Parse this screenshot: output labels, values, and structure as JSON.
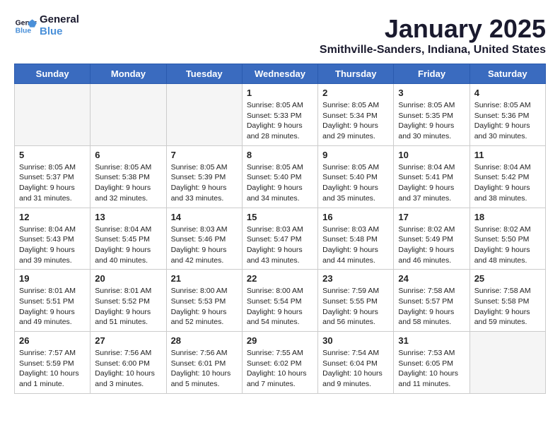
{
  "header": {
    "logo_line1": "General",
    "logo_line2": "Blue",
    "month": "January 2025",
    "location": "Smithville-Sanders, Indiana, United States"
  },
  "weekdays": [
    "Sunday",
    "Monday",
    "Tuesday",
    "Wednesday",
    "Thursday",
    "Friday",
    "Saturday"
  ],
  "weeks": [
    [
      {
        "day": "",
        "info": ""
      },
      {
        "day": "",
        "info": ""
      },
      {
        "day": "",
        "info": ""
      },
      {
        "day": "1",
        "info": "Sunrise: 8:05 AM\nSunset: 5:33 PM\nDaylight: 9 hours\nand 28 minutes."
      },
      {
        "day": "2",
        "info": "Sunrise: 8:05 AM\nSunset: 5:34 PM\nDaylight: 9 hours\nand 29 minutes."
      },
      {
        "day": "3",
        "info": "Sunrise: 8:05 AM\nSunset: 5:35 PM\nDaylight: 9 hours\nand 30 minutes."
      },
      {
        "day": "4",
        "info": "Sunrise: 8:05 AM\nSunset: 5:36 PM\nDaylight: 9 hours\nand 30 minutes."
      }
    ],
    [
      {
        "day": "5",
        "info": "Sunrise: 8:05 AM\nSunset: 5:37 PM\nDaylight: 9 hours\nand 31 minutes."
      },
      {
        "day": "6",
        "info": "Sunrise: 8:05 AM\nSunset: 5:38 PM\nDaylight: 9 hours\nand 32 minutes."
      },
      {
        "day": "7",
        "info": "Sunrise: 8:05 AM\nSunset: 5:39 PM\nDaylight: 9 hours\nand 33 minutes."
      },
      {
        "day": "8",
        "info": "Sunrise: 8:05 AM\nSunset: 5:40 PM\nDaylight: 9 hours\nand 34 minutes."
      },
      {
        "day": "9",
        "info": "Sunrise: 8:05 AM\nSunset: 5:40 PM\nDaylight: 9 hours\nand 35 minutes."
      },
      {
        "day": "10",
        "info": "Sunrise: 8:04 AM\nSunset: 5:41 PM\nDaylight: 9 hours\nand 37 minutes."
      },
      {
        "day": "11",
        "info": "Sunrise: 8:04 AM\nSunset: 5:42 PM\nDaylight: 9 hours\nand 38 minutes."
      }
    ],
    [
      {
        "day": "12",
        "info": "Sunrise: 8:04 AM\nSunset: 5:43 PM\nDaylight: 9 hours\nand 39 minutes."
      },
      {
        "day": "13",
        "info": "Sunrise: 8:04 AM\nSunset: 5:45 PM\nDaylight: 9 hours\nand 40 minutes."
      },
      {
        "day": "14",
        "info": "Sunrise: 8:03 AM\nSunset: 5:46 PM\nDaylight: 9 hours\nand 42 minutes."
      },
      {
        "day": "15",
        "info": "Sunrise: 8:03 AM\nSunset: 5:47 PM\nDaylight: 9 hours\nand 43 minutes."
      },
      {
        "day": "16",
        "info": "Sunrise: 8:03 AM\nSunset: 5:48 PM\nDaylight: 9 hours\nand 44 minutes."
      },
      {
        "day": "17",
        "info": "Sunrise: 8:02 AM\nSunset: 5:49 PM\nDaylight: 9 hours\nand 46 minutes."
      },
      {
        "day": "18",
        "info": "Sunrise: 8:02 AM\nSunset: 5:50 PM\nDaylight: 9 hours\nand 48 minutes."
      }
    ],
    [
      {
        "day": "19",
        "info": "Sunrise: 8:01 AM\nSunset: 5:51 PM\nDaylight: 9 hours\nand 49 minutes."
      },
      {
        "day": "20",
        "info": "Sunrise: 8:01 AM\nSunset: 5:52 PM\nDaylight: 9 hours\nand 51 minutes."
      },
      {
        "day": "21",
        "info": "Sunrise: 8:00 AM\nSunset: 5:53 PM\nDaylight: 9 hours\nand 52 minutes."
      },
      {
        "day": "22",
        "info": "Sunrise: 8:00 AM\nSunset: 5:54 PM\nDaylight: 9 hours\nand 54 minutes."
      },
      {
        "day": "23",
        "info": "Sunrise: 7:59 AM\nSunset: 5:55 PM\nDaylight: 9 hours\nand 56 minutes."
      },
      {
        "day": "24",
        "info": "Sunrise: 7:58 AM\nSunset: 5:57 PM\nDaylight: 9 hours\nand 58 minutes."
      },
      {
        "day": "25",
        "info": "Sunrise: 7:58 AM\nSunset: 5:58 PM\nDaylight: 9 hours\nand 59 minutes."
      }
    ],
    [
      {
        "day": "26",
        "info": "Sunrise: 7:57 AM\nSunset: 5:59 PM\nDaylight: 10 hours\nand 1 minute."
      },
      {
        "day": "27",
        "info": "Sunrise: 7:56 AM\nSunset: 6:00 PM\nDaylight: 10 hours\nand 3 minutes."
      },
      {
        "day": "28",
        "info": "Sunrise: 7:56 AM\nSunset: 6:01 PM\nDaylight: 10 hours\nand 5 minutes."
      },
      {
        "day": "29",
        "info": "Sunrise: 7:55 AM\nSunset: 6:02 PM\nDaylight: 10 hours\nand 7 minutes."
      },
      {
        "day": "30",
        "info": "Sunrise: 7:54 AM\nSunset: 6:04 PM\nDaylight: 10 hours\nand 9 minutes."
      },
      {
        "day": "31",
        "info": "Sunrise: 7:53 AM\nSunset: 6:05 PM\nDaylight: 10 hours\nand 11 minutes."
      },
      {
        "day": "",
        "info": ""
      }
    ]
  ]
}
